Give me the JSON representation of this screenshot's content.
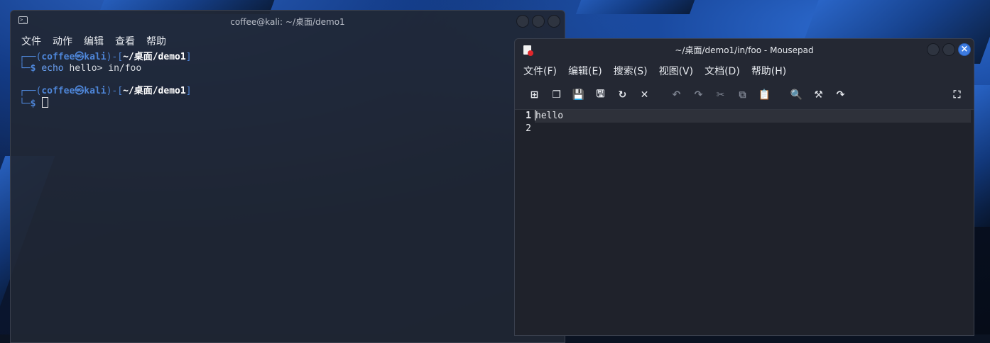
{
  "terminal": {
    "title": "coffee@kali: ~/桌面/demo1",
    "menu": [
      "文件",
      "动作",
      "编辑",
      "查看",
      "帮助"
    ],
    "prompts": [
      {
        "frame_top": "┌──(",
        "user": "coffee㉿kali",
        "mid": ")-[",
        "path": "~/桌面/demo1",
        "close": "]",
        "frame_bottom": "└─",
        "dollar": "$",
        "command_word": "echo",
        "command_rest": " hello> in/foo"
      },
      {
        "frame_top": "┌──(",
        "user": "coffee㉿kali",
        "mid": ")-[",
        "path": "~/桌面/demo1",
        "close": "]",
        "frame_bottom": "└─",
        "dollar": "$"
      }
    ]
  },
  "mousepad": {
    "title": "~/桌面/demo1/in/foo - Mousepad",
    "menu": [
      "文件(F)",
      "编辑(E)",
      "搜索(S)",
      "视图(V)",
      "文档(D)",
      "帮助(H)"
    ],
    "toolbar": {
      "new": "⊞",
      "new_window": "❐",
      "save": "💾",
      "save_as": "🖫",
      "reload": "↻",
      "close": "✕",
      "undo": "↶",
      "redo": "↷",
      "cut": "✂",
      "copy": "⧉",
      "paste": "📋",
      "find": "🔍",
      "find_replace": "⚒",
      "goto": "↷",
      "fullscreen": "⛶"
    },
    "window_close": "×",
    "line_numbers": [
      "1",
      "2"
    ],
    "lines": [
      "hello",
      ""
    ]
  }
}
